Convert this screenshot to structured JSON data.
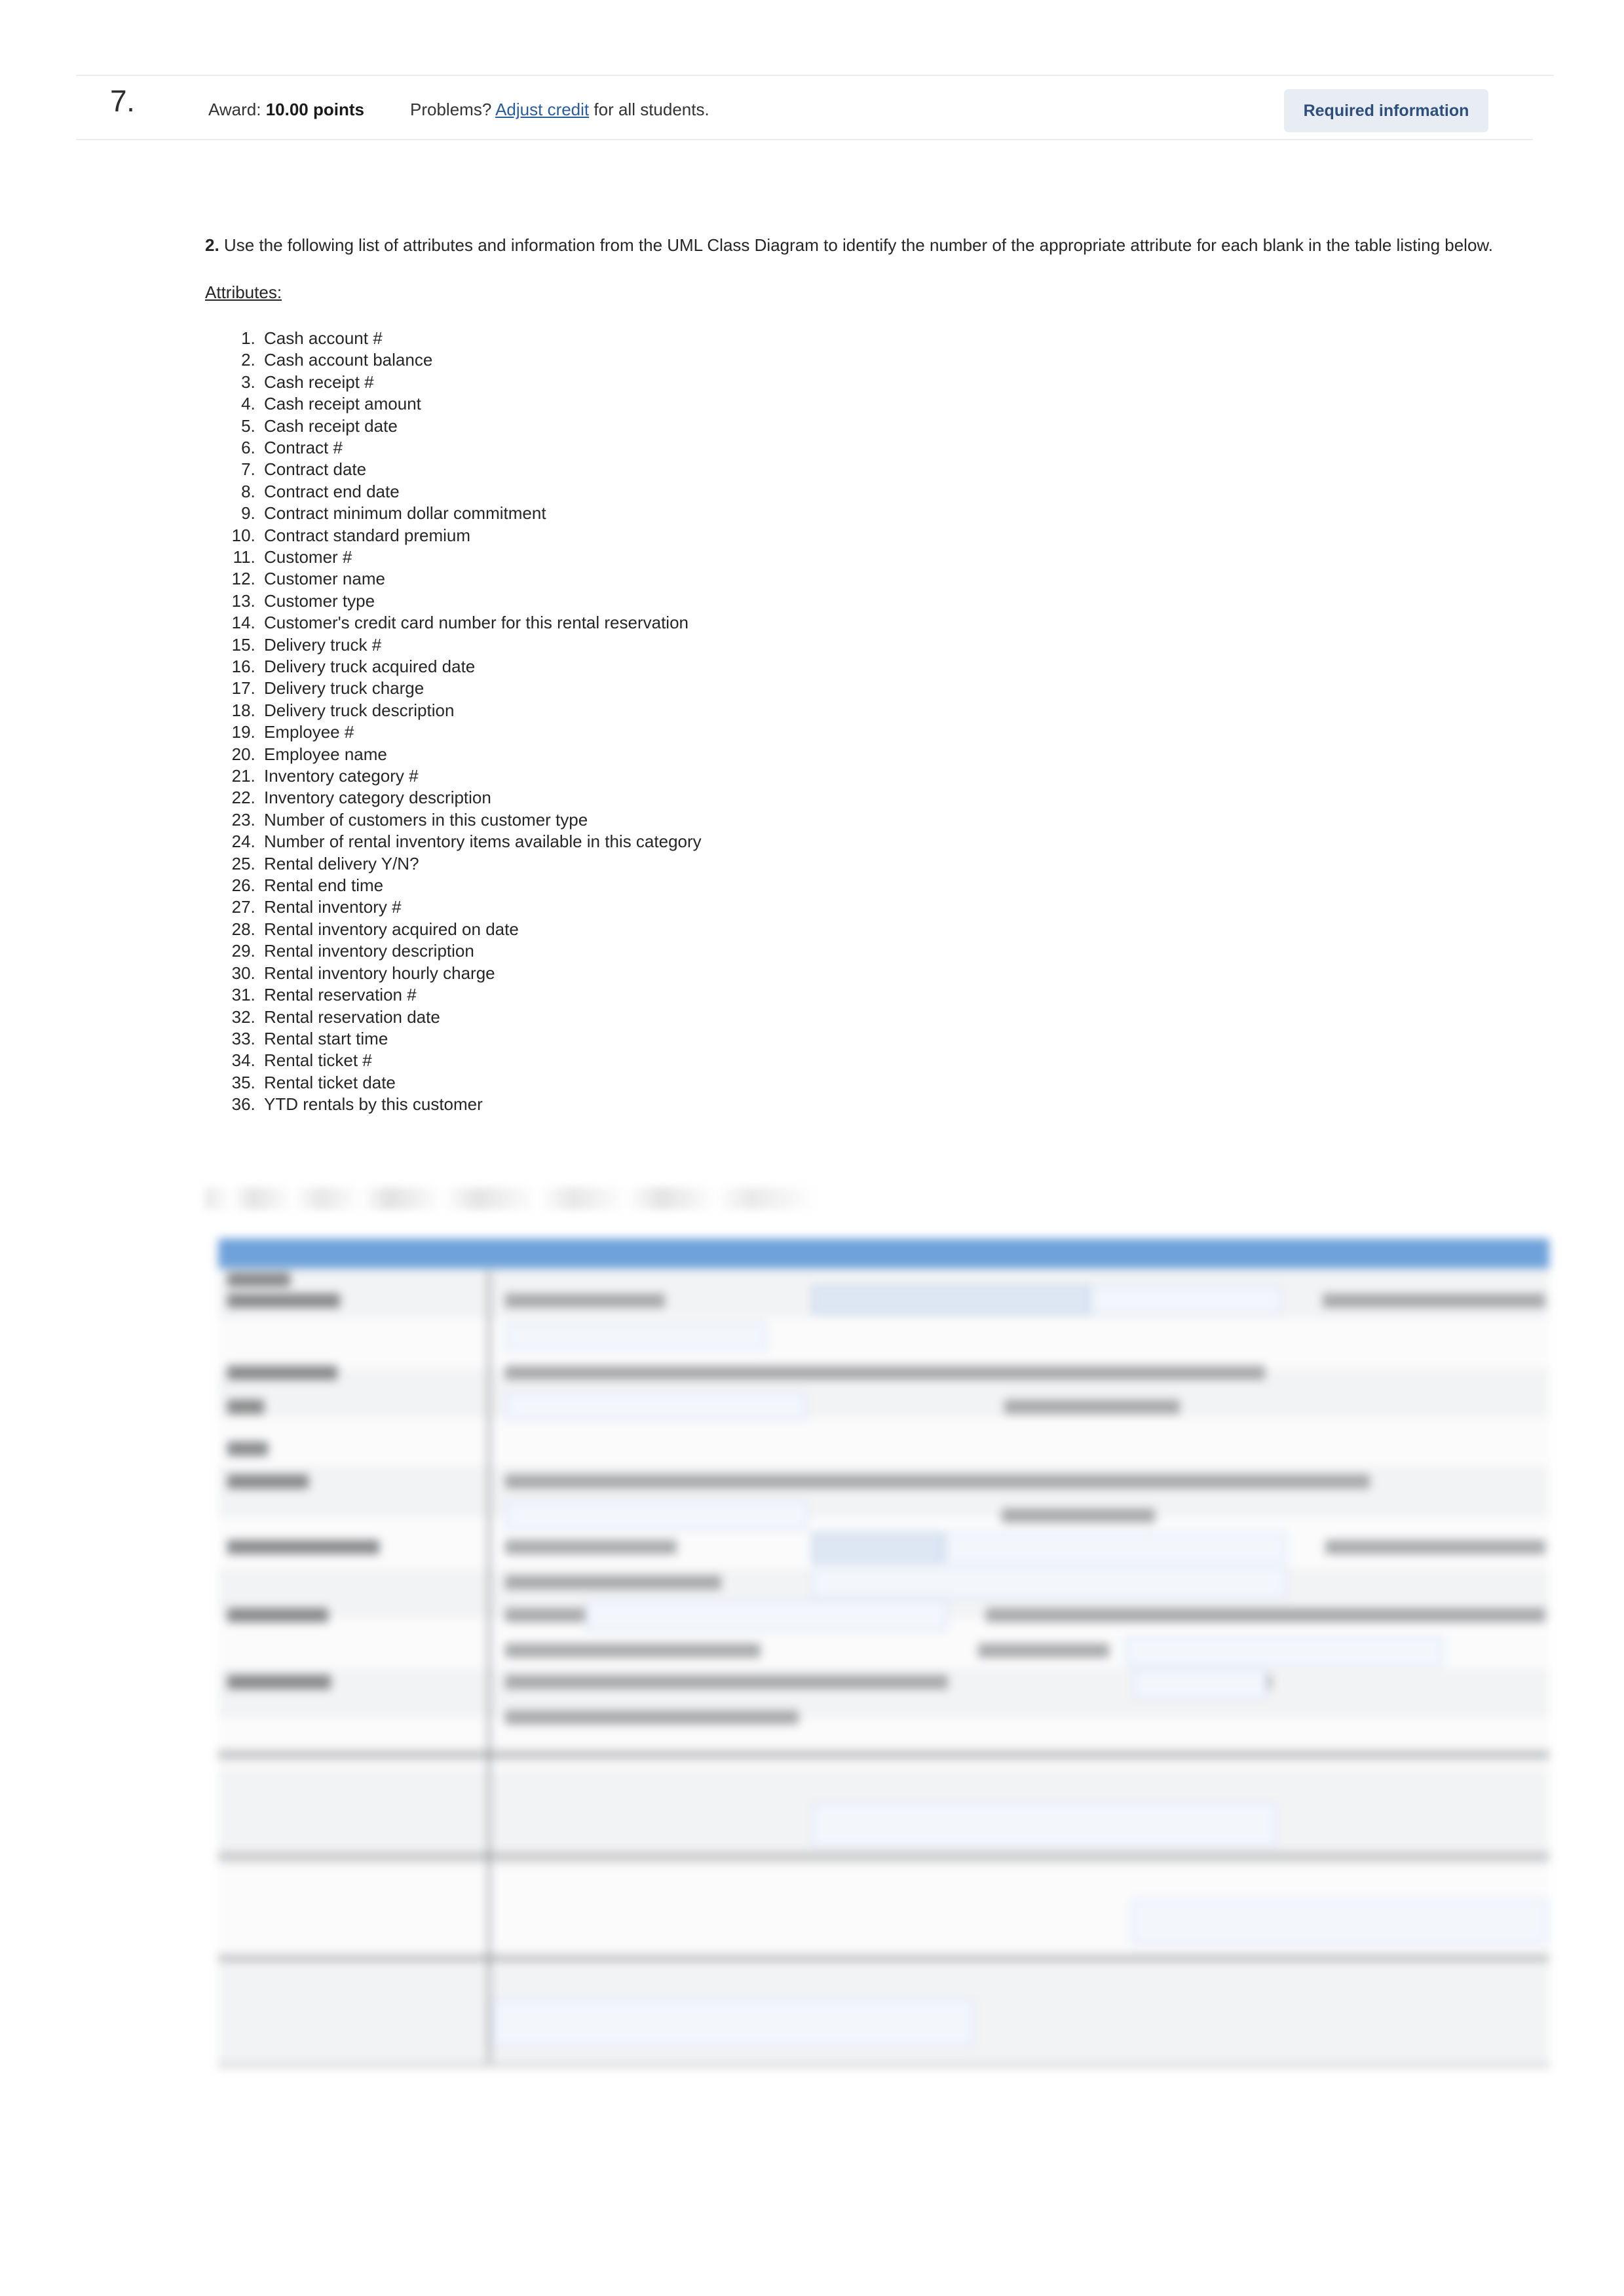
{
  "question": {
    "number": "7.",
    "award_label": "Award:",
    "award_value": "10.00 points",
    "problems_prefix": "Problems?",
    "adjust_credit_link": "Adjust credit",
    "problems_suffix": "for all students.",
    "required_information_button": "Required information"
  },
  "body": {
    "prompt_number": "2.",
    "prompt_text": "Use the following list of attributes and information from the UML Class Diagram to identify the number of the appropriate attribute for each blank in the table listing below.",
    "attributes_heading": "Attributes:",
    "attributes": [
      "Cash account #",
      "Cash account balance",
      "Cash receipt #",
      "Cash receipt amount",
      "Cash receipt date",
      "Contract #",
      "Contract date",
      "Contract end date",
      "Contract minimum dollar commitment",
      "Contract standard premium",
      "Customer #",
      "Customer name",
      "Customer type",
      "Customer's credit card number for this rental reservation",
      "Delivery truck #",
      "Delivery truck acquired date",
      "Delivery truck charge",
      "Delivery truck description",
      "Employee #",
      "Employee name",
      "Inventory category #",
      "Inventory category description",
      "Number of customers in this customer type",
      "Number of rental inventory items available in this category",
      "Rental delivery Y/N?",
      "Rental end time",
      "Rental inventory #",
      "Rental inventory acquired on date",
      "Rental inventory description",
      "Rental inventory hourly charge",
      "Rental reservation #",
      "Rental reservation date",
      "Rental start time",
      "Rental ticket #",
      "Rental ticket date",
      "YTD rentals by this customer"
    ]
  },
  "redacted": {
    "instruction_line": "",
    "table_note": ""
  },
  "colors": {
    "table_header_blue": "#6fa2da",
    "required_button_bg": "#e8edf4",
    "required_button_text": "#2e4f7c",
    "link_blue": "#2b5c9b",
    "rule_gray": "#eceded",
    "row_band_gray": "#c9cacb",
    "input_fill": "#dde6f3"
  }
}
